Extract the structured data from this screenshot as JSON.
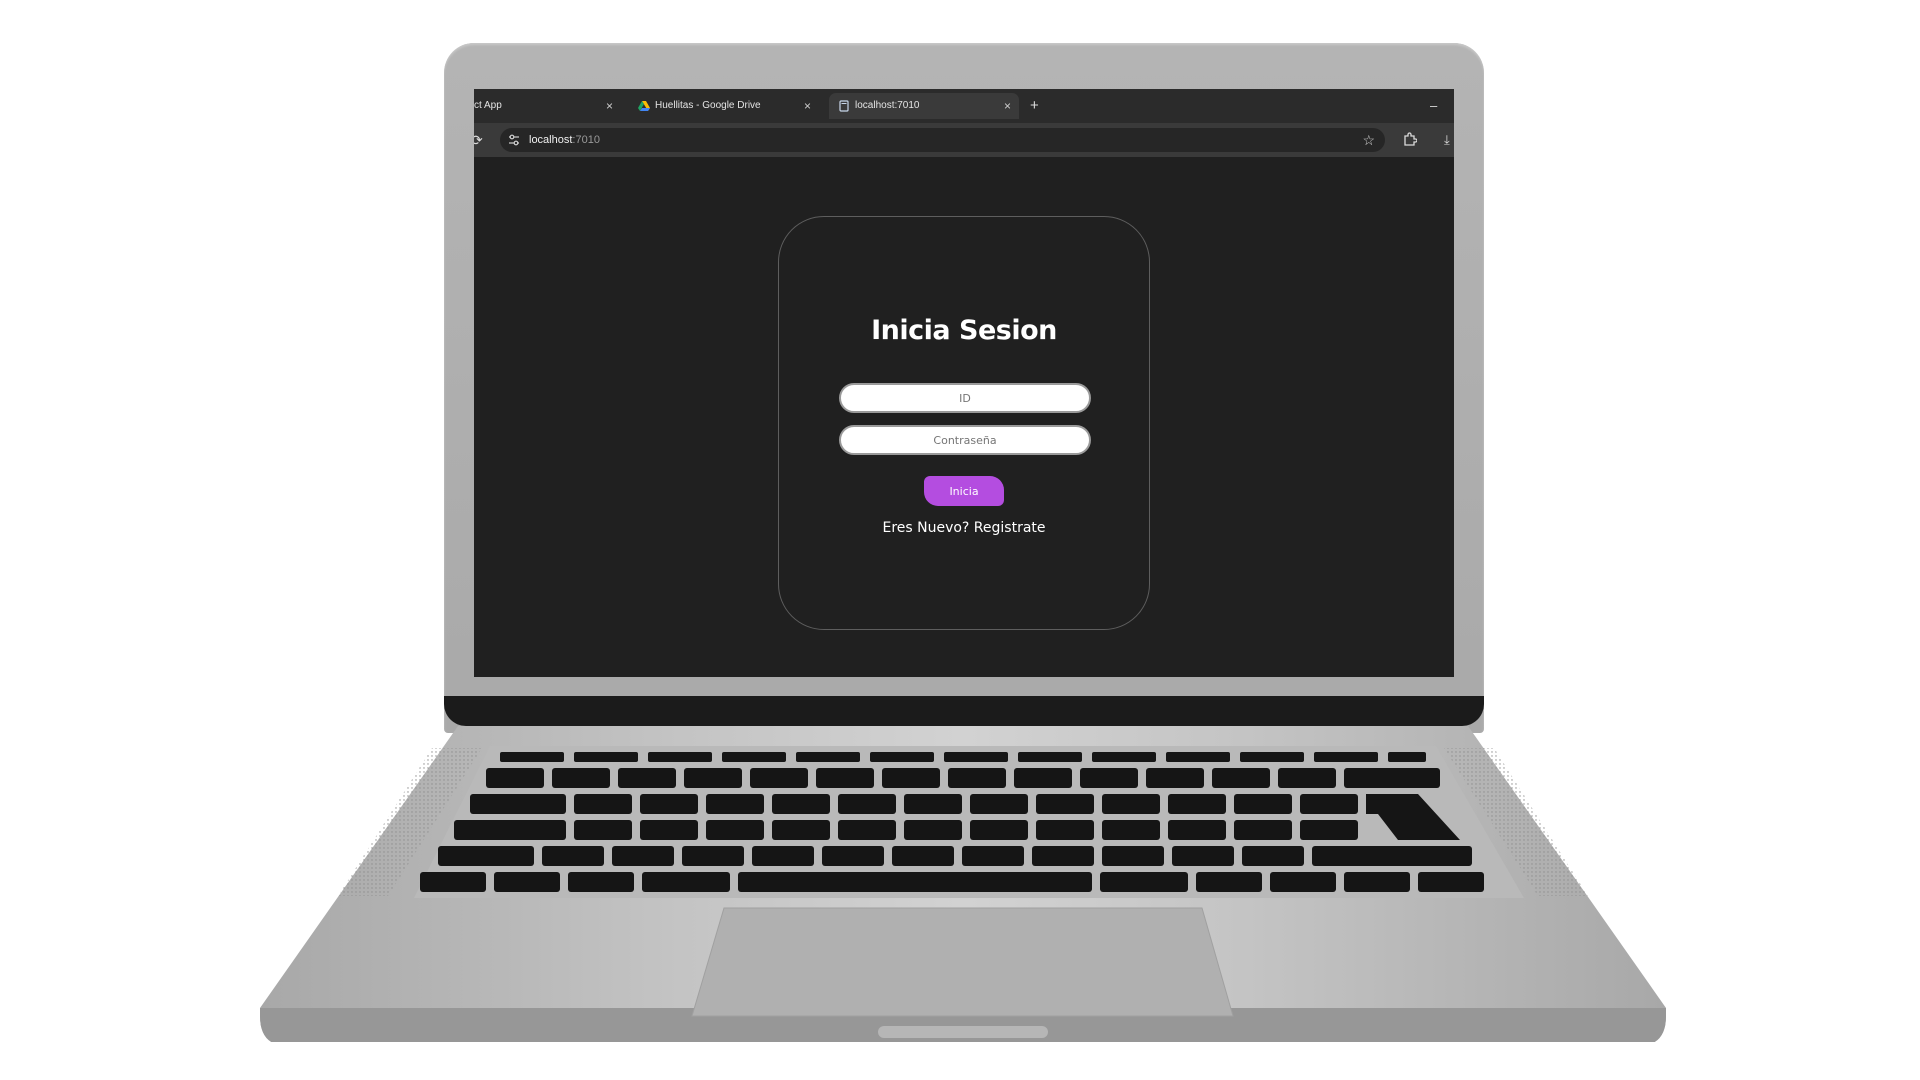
{
  "browser": {
    "tabs": [
      {
        "title": "ct App",
        "close": "×"
      },
      {
        "title": "Huellitas - Google Drive",
        "close": "×"
      },
      {
        "title": "localhost:7010",
        "close": "×",
        "active": true
      }
    ],
    "new_tab": "+",
    "minimize": "–",
    "address": {
      "host": "localhost",
      "port": ":7010"
    }
  },
  "login": {
    "title": "Inicia Sesion",
    "id_placeholder": "ID",
    "password_placeholder": "Contraseña",
    "submit_label": "Inicia",
    "register_text": "Eres Nuevo? Registrate"
  },
  "colors": {
    "page_bg": "#202020",
    "accent": "#b44de0",
    "card_border": "#5e5e5e"
  },
  "icons": [
    "reload-icon",
    "tune-icon",
    "star-icon",
    "extensions-icon",
    "download-icon",
    "google-drive-icon",
    "page-icon"
  ]
}
